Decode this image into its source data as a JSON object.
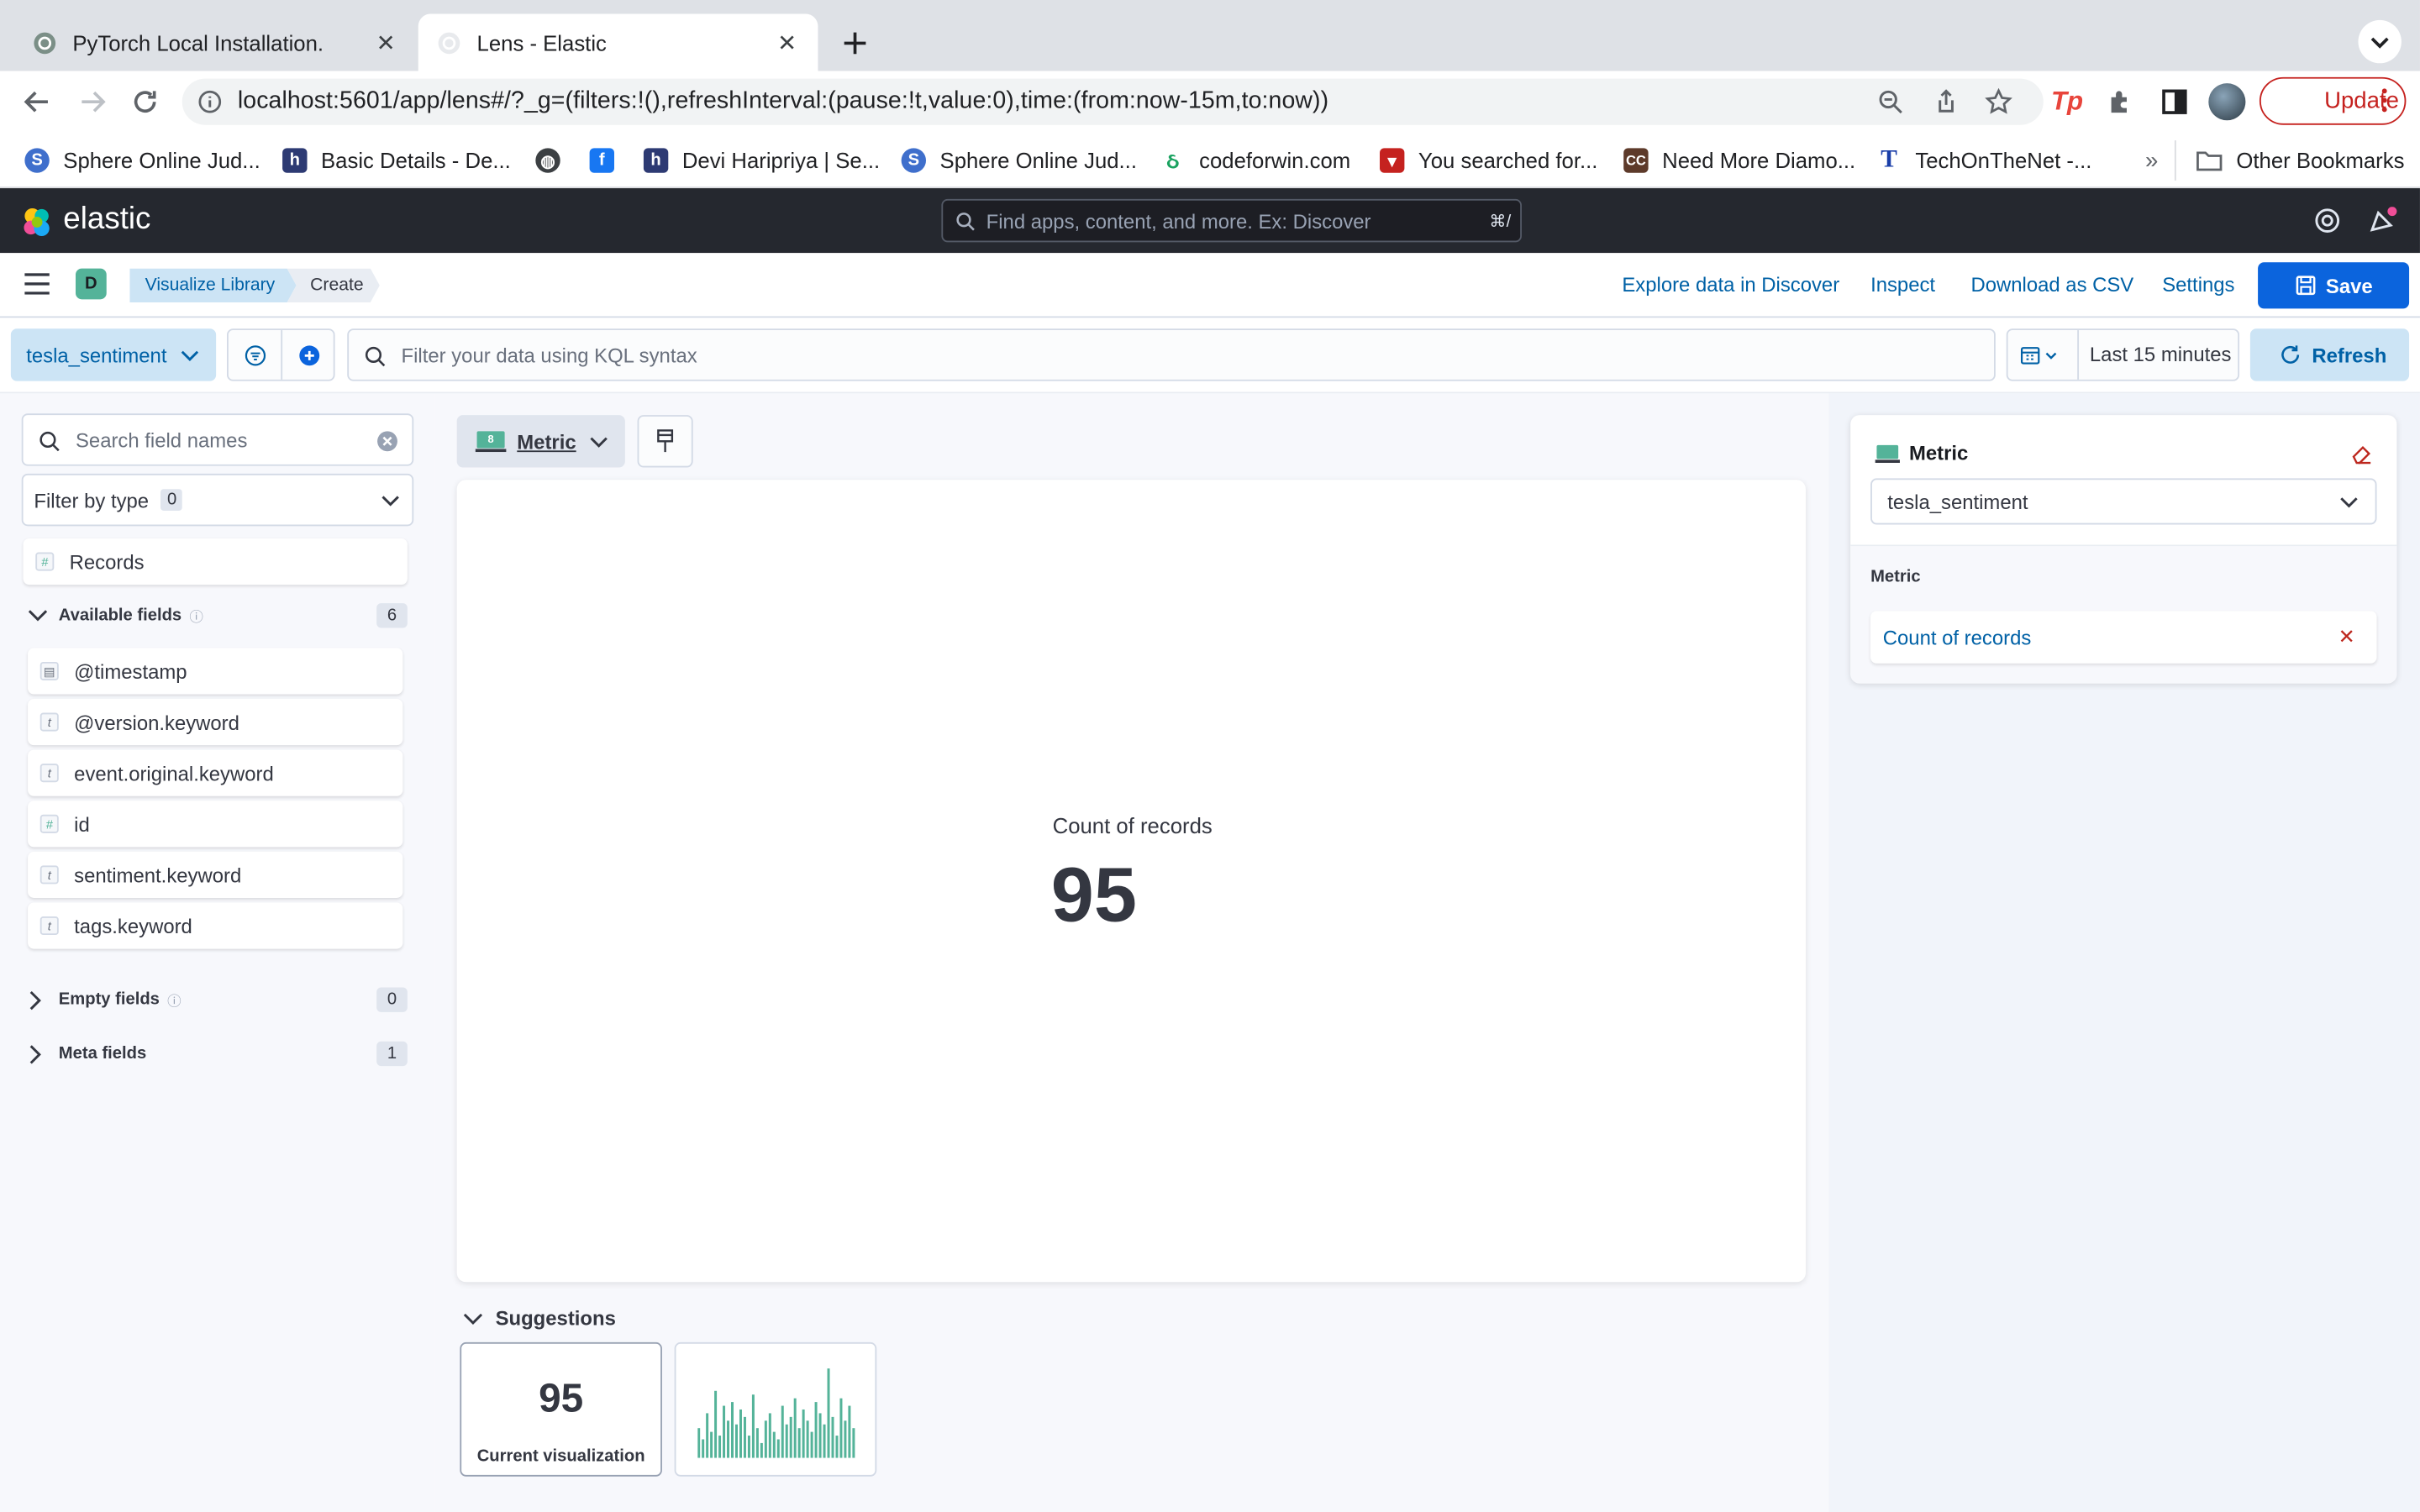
{
  "browser": {
    "tabs": [
      {
        "title": "PyTorch Local Installation.",
        "active": false
      },
      {
        "title": "Lens - Elastic",
        "active": true
      }
    ],
    "url": "localhost:5601/app/lens#/?_g=(filters:!(),refreshInterval:(pause:!t,value:0),time:(from:now-15m,to:now))",
    "update_label": "Update",
    "bookmarks": [
      {
        "label": "Sphere Online Jud...",
        "icon": "sphere-icon"
      },
      {
        "label": "Basic Details - De...",
        "icon": "h-icon"
      },
      {
        "label": "",
        "icon": "globe-icon"
      },
      {
        "label": "",
        "icon": "facebook-icon"
      },
      {
        "label": "Devi Haripriya | Se...",
        "icon": "h-icon"
      },
      {
        "label": "Sphere Online Jud...",
        "icon": "sphere-icon"
      },
      {
        "label": "codeforwin.com",
        "icon": "codeforwin-icon"
      },
      {
        "label": "You searched for...",
        "icon": "cup-icon"
      },
      {
        "label": "Need More Diamo...",
        "icon": "cc-icon"
      },
      {
        "label": "TechOnTheNet -...",
        "icon": "t-icon"
      }
    ],
    "other_bookmarks": "Other Bookmarks"
  },
  "kibana": {
    "brand": "elastic",
    "search_placeholder": "Find apps, content, and more. Ex: Discover",
    "search_shortcut": "⌘/",
    "space_letter": "D",
    "breadcrumbs": [
      "Visualize Library",
      "Create"
    ],
    "top_links": [
      "Explore data in Discover",
      "Inspect",
      "Download as CSV",
      "Settings"
    ],
    "save_label": "Save",
    "data_view": "tesla_sentiment",
    "kql_placeholder": "Filter your data using KQL syntax",
    "time_range": "Last 15 minutes",
    "refresh_label": "Refresh"
  },
  "left_panel": {
    "search_placeholder": "Search field names",
    "filter_by_type": "Filter by type",
    "filter_count": "0",
    "records_label": "Records",
    "available_label": "Available fields",
    "available_count": "6",
    "fields": [
      {
        "name": "@timestamp",
        "type": "date"
      },
      {
        "name": "@version.keyword",
        "type": "t"
      },
      {
        "name": "event.original.keyword",
        "type": "t"
      },
      {
        "name": "id",
        "type": "#"
      },
      {
        "name": "sentiment.keyword",
        "type": "t"
      },
      {
        "name": "tags.keyword",
        "type": "t"
      }
    ],
    "empty_label": "Empty fields",
    "empty_count": "0",
    "meta_label": "Meta fields",
    "meta_count": "1"
  },
  "workspace": {
    "chart_type": "Metric",
    "metric_label": "Count of records",
    "metric_value": "95",
    "suggestions_label": "Suggestions",
    "suggestion_current_value": "95",
    "suggestion_current_label": "Current visualization"
  },
  "chart_data": {
    "type": "bar",
    "title": "",
    "values": [
      8,
      5,
      12,
      7,
      18,
      6,
      14,
      10,
      15,
      9,
      13,
      11,
      6,
      17,
      8,
      4,
      10,
      12,
      7,
      5,
      14,
      9,
      11,
      16,
      8,
      13,
      10,
      7,
      15,
      12,
      9,
      24,
      11,
      6,
      16,
      10,
      14,
      8
    ],
    "color": "#54b399"
  },
  "right_panel": {
    "title": "Metric",
    "data_view": "tesla_sentiment",
    "group_label": "Metric",
    "dimension": "Count of records"
  },
  "colors": {
    "primary": "#0b64dd",
    "link": "#0061a6",
    "chart": "#54b399",
    "header": "#25282f"
  }
}
